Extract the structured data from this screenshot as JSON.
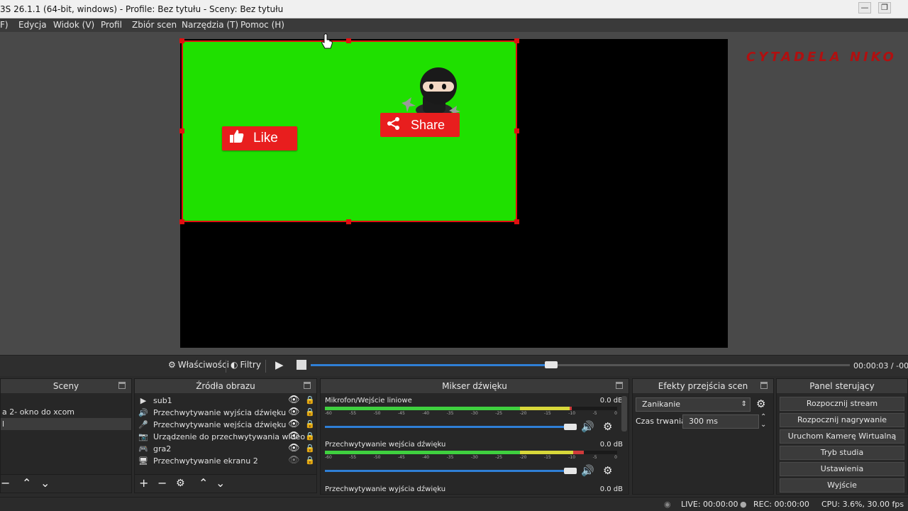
{
  "window": {
    "title": "3S 26.1.1 (64-bit, windows) - Profile: Bez tytułu - Sceny: Bez tytułu",
    "minimize": "—",
    "restore": "❐"
  },
  "menu": [
    "F)",
    "Edycja",
    "Widok (V)",
    "Profil",
    "Zbiór scen",
    "Narzędzia (T)",
    "Pomoc (H)"
  ],
  "preview": {
    "watermark": "CYTADELA NIKO",
    "like_label": "Like",
    "share_label": "Share",
    "colors": {
      "green_screen": "#1fe000",
      "selection": "#e01010",
      "button_red": "#e81e1e"
    }
  },
  "playback": {
    "properties_label": "Właściwości",
    "filters_label": "Filtry",
    "timecode": "00:00:03 / -00:",
    "progress": 0.45
  },
  "scenes": {
    "title": "Sceny",
    "items": [
      "a 2- okno do xcom",
      "l"
    ]
  },
  "sources": {
    "title": "Źródła obrazu",
    "items": [
      {
        "label": "sub1",
        "icon": "play-icon"
      },
      {
        "label": "Przechwytywanie wyjścia dźwięku",
        "icon": "speaker-icon"
      },
      {
        "label": "Przechwytywanie wejścia dźwięku",
        "icon": "microphone-icon"
      },
      {
        "label": "Urządzenie do przechwytywania wideo",
        "icon": "camera-icon"
      },
      {
        "label": "gra2",
        "icon": "gamepad-icon"
      },
      {
        "label": "Przechwytywanie ekranu 2",
        "icon": "monitor-icon"
      }
    ]
  },
  "mixer": {
    "title": "Mikser dźwięku",
    "scale": [
      "-60",
      "-55",
      "-50",
      "-45",
      "-40",
      "-35",
      "-30",
      "-25",
      "-20",
      "-15",
      "-10",
      "-5",
      "0"
    ],
    "channels": [
      {
        "name": "Mikrofon/Wejście liniowe",
        "db": "0.0 dB",
        "level": 0.78
      },
      {
        "name": "Przechwytywanie wejścia dźwięku",
        "db": "0.0 dB",
        "level": 0.85
      },
      {
        "name": "Przechwytywanie wyjścia dźwięku",
        "db": "0.0 dB",
        "level": 0.0
      }
    ]
  },
  "transitions": {
    "title": "Efekty przejścia scen",
    "selected": "Zanikanie",
    "duration_label": "Czas trwania",
    "duration_value": "300 ms"
  },
  "controls": {
    "title": "Panel sterujący",
    "buttons": [
      "Rozpocznij stream",
      "Rozpocznij nagrywanie",
      "Uruchom Kamerę Wirtualną",
      "Tryb studia",
      "Ustawienia",
      "Wyjście"
    ]
  },
  "status": {
    "live": "LIVE: 00:00:00",
    "rec": "REC: 00:00:00",
    "cpu": "CPU: 3.6%, 30.00 fps"
  }
}
